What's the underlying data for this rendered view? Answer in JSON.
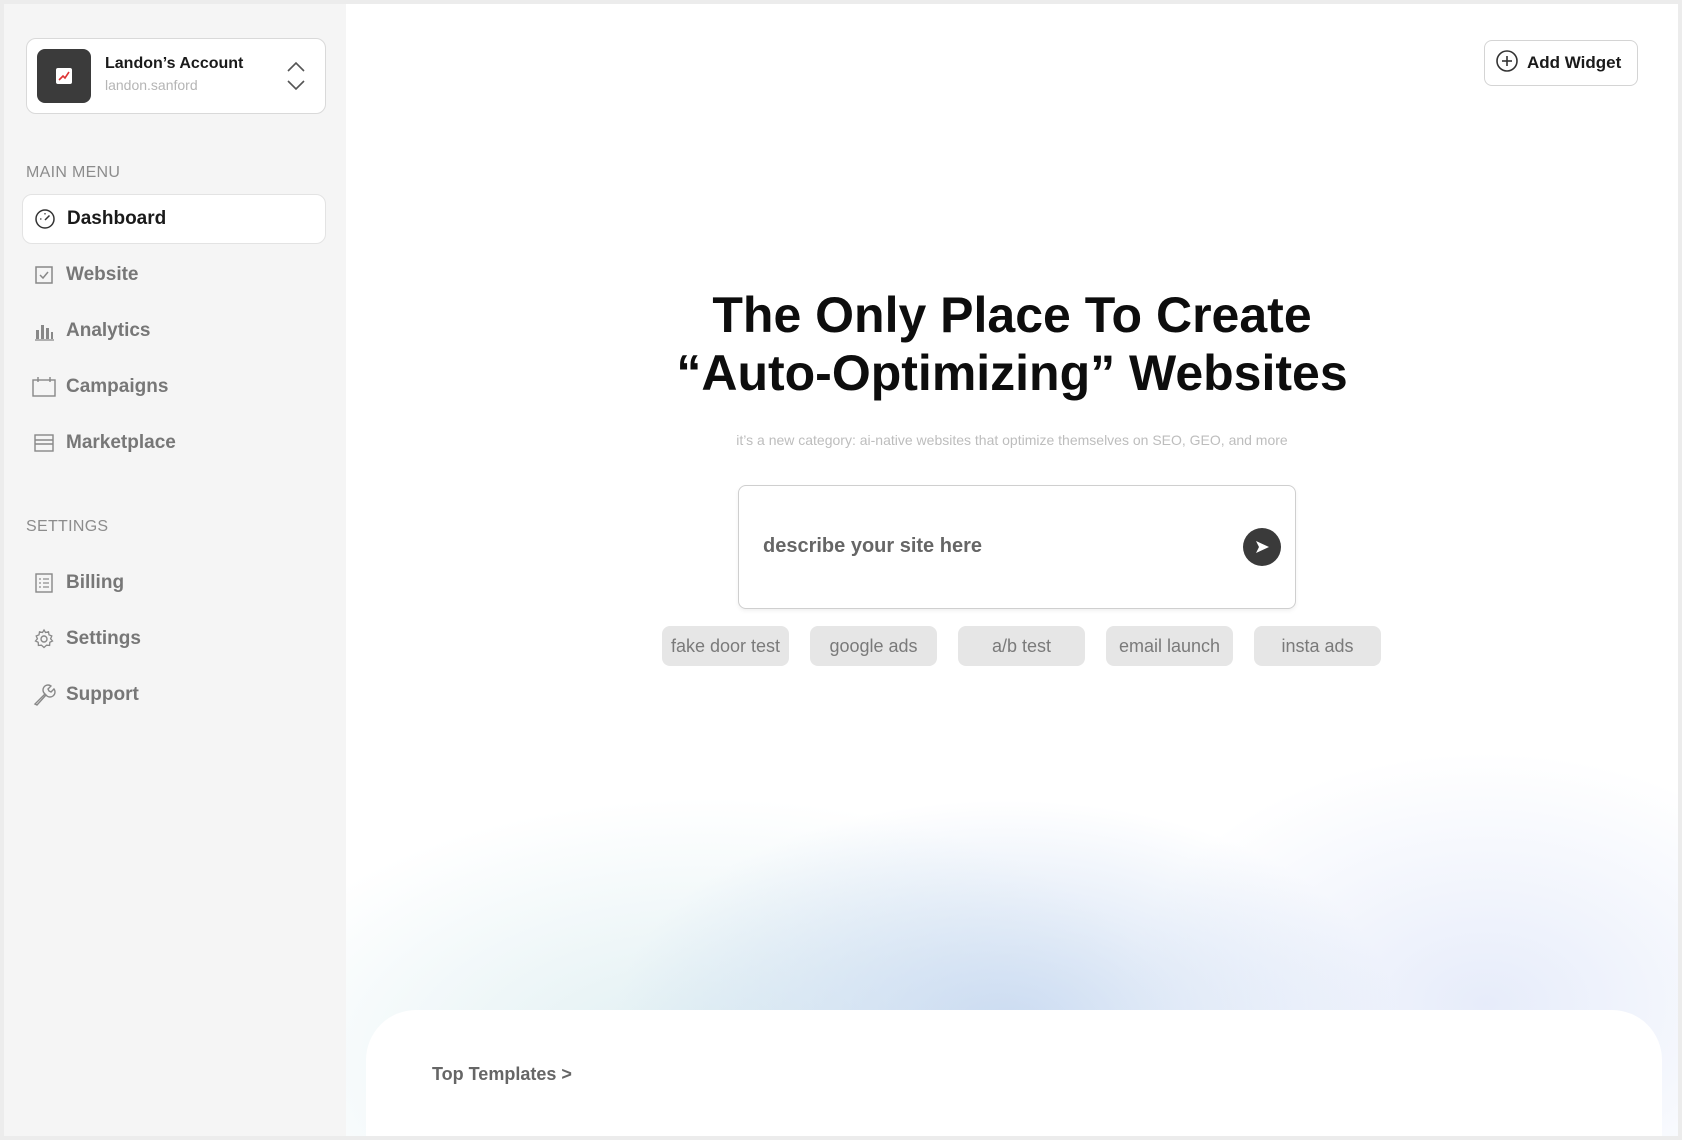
{
  "account": {
    "name": "Landon’s Account",
    "handle": "landon.sanford",
    "avatar_icon": "chart-icon",
    "switch_icon": "chevron-up-down-icon"
  },
  "sidebar": {
    "main_menu_label": "MAIN MENU",
    "main_items": [
      {
        "label": "Dashboard",
        "icon": "gauge-icon",
        "active": true
      },
      {
        "label": "Website",
        "icon": "checkbox-icon",
        "active": false
      },
      {
        "label": "Analytics",
        "icon": "bar-chart-icon",
        "active": false
      },
      {
        "label": "Campaigns",
        "icon": "calendar-icon",
        "active": false
      },
      {
        "label": "Marketplace",
        "icon": "store-icon",
        "active": false
      }
    ],
    "settings_label": "SETTINGS",
    "settings_items": [
      {
        "label": "Billing",
        "icon": "receipt-icon"
      },
      {
        "label": "Settings",
        "icon": "gear-icon"
      },
      {
        "label": "Support",
        "icon": "wrench-icon"
      }
    ]
  },
  "header": {
    "add_widget_label": "Add Widget"
  },
  "hero": {
    "title_line1": "The Only Place To Create",
    "title_line2": "“Auto-Optimizing” Websites",
    "subtitle": "it’s a new category: ai-native websites that optimize themselves on SEO, GEO, and more",
    "prompt_placeholder": "describe your site here"
  },
  "chips": [
    "fake door test",
    "google ads",
    "a/b test",
    "email launch",
    "insta ads"
  ],
  "templates": {
    "link_label": "Top Templates >"
  },
  "colors": {
    "sidebar_bg": "#f5f5f5",
    "accent_dark": "#3a3a3a",
    "chip_bg": "#e6e6e6"
  }
}
